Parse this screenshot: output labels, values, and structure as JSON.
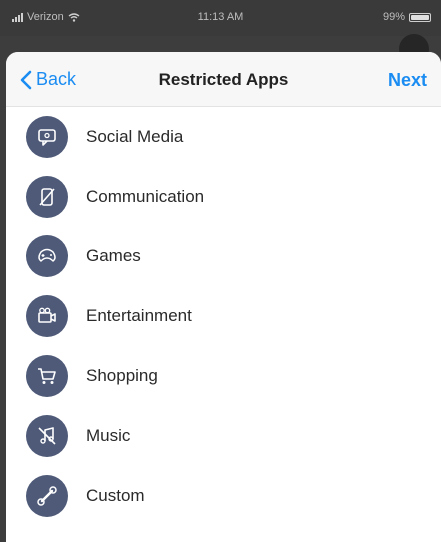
{
  "status_bar": {
    "carrier": "Verizon",
    "time": "11:13 AM",
    "battery": "99%",
    "battery_level": 0.99
  },
  "nav": {
    "back_label": "Back",
    "title": "Restricted Apps",
    "next_label": "Next"
  },
  "categories": [
    {
      "label": "Social Media",
      "icon": "chat-bubble-icon"
    },
    {
      "label": "Communication",
      "icon": "phone-off-icon"
    },
    {
      "label": "Games",
      "icon": "game-controller-icon"
    },
    {
      "label": "Entertainment",
      "icon": "video-camera-icon"
    },
    {
      "label": "Shopping",
      "icon": "shopping-cart-icon"
    },
    {
      "label": "Music",
      "icon": "music-off-icon"
    },
    {
      "label": "Custom",
      "icon": "wrench-icon"
    }
  ],
  "colors": {
    "accent": "#1a8cf2",
    "icon_background": "#4e5a78",
    "nav_background": "#f7f7f7"
  }
}
